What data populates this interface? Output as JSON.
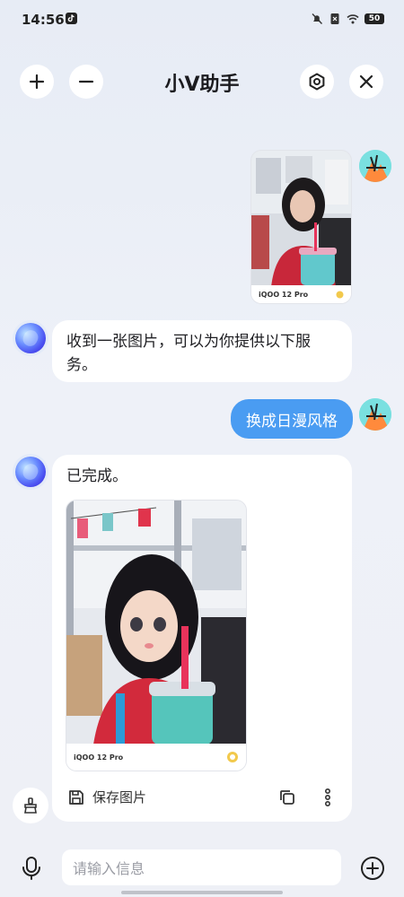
{
  "status_bar": {
    "time": "14:56",
    "battery": "50"
  },
  "header": {
    "title": "小V助手"
  },
  "messages": {
    "bot_reply_1": "收到一张图片，可以为你提供以下服务。",
    "user_request": "换成日漫风格",
    "bot_reply_2": "已完成。",
    "original_photo_caption": "iQOO 12 Pro",
    "generated_photo_caption": "iQOO 12 Pro",
    "save_image": "保存图片"
  },
  "input": {
    "placeholder": "请输入信息"
  },
  "icons": {
    "add": "plus-icon",
    "remove": "minus-icon",
    "settings": "gear-icon",
    "close": "close-icon",
    "mic": "microphone-icon",
    "attach": "plus-circle-icon",
    "brush": "brush-icon",
    "save": "save-icon",
    "copy": "copy-icon",
    "more": "more-vertical-icon"
  },
  "colors": {
    "accent": "#4a9cf2",
    "background": "#eef0f6",
    "card": "#ffffff"
  }
}
